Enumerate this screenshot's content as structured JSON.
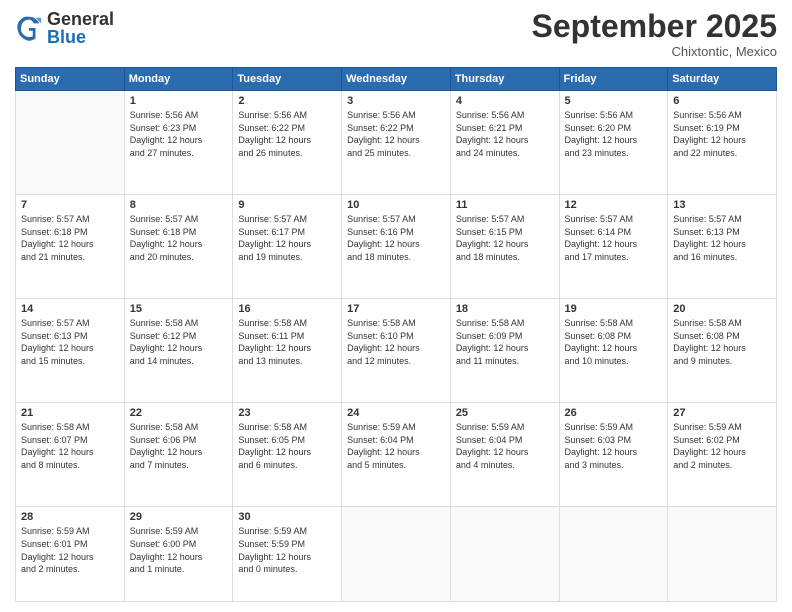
{
  "header": {
    "logo": {
      "general": "General",
      "blue": "Blue"
    },
    "month": "September 2025",
    "location": "Chixtontic, Mexico"
  },
  "weekdays": [
    "Sunday",
    "Monday",
    "Tuesday",
    "Wednesday",
    "Thursday",
    "Friday",
    "Saturday"
  ],
  "weeks": [
    [
      {
        "day": "",
        "info": ""
      },
      {
        "day": "1",
        "info": "Sunrise: 5:56 AM\nSunset: 6:23 PM\nDaylight: 12 hours\nand 27 minutes."
      },
      {
        "day": "2",
        "info": "Sunrise: 5:56 AM\nSunset: 6:22 PM\nDaylight: 12 hours\nand 26 minutes."
      },
      {
        "day": "3",
        "info": "Sunrise: 5:56 AM\nSunset: 6:22 PM\nDaylight: 12 hours\nand 25 minutes."
      },
      {
        "day": "4",
        "info": "Sunrise: 5:56 AM\nSunset: 6:21 PM\nDaylight: 12 hours\nand 24 minutes."
      },
      {
        "day": "5",
        "info": "Sunrise: 5:56 AM\nSunset: 6:20 PM\nDaylight: 12 hours\nand 23 minutes."
      },
      {
        "day": "6",
        "info": "Sunrise: 5:56 AM\nSunset: 6:19 PM\nDaylight: 12 hours\nand 22 minutes."
      }
    ],
    [
      {
        "day": "7",
        "info": "Sunrise: 5:57 AM\nSunset: 6:18 PM\nDaylight: 12 hours\nand 21 minutes."
      },
      {
        "day": "8",
        "info": "Sunrise: 5:57 AM\nSunset: 6:18 PM\nDaylight: 12 hours\nand 20 minutes."
      },
      {
        "day": "9",
        "info": "Sunrise: 5:57 AM\nSunset: 6:17 PM\nDaylight: 12 hours\nand 19 minutes."
      },
      {
        "day": "10",
        "info": "Sunrise: 5:57 AM\nSunset: 6:16 PM\nDaylight: 12 hours\nand 18 minutes."
      },
      {
        "day": "11",
        "info": "Sunrise: 5:57 AM\nSunset: 6:15 PM\nDaylight: 12 hours\nand 18 minutes."
      },
      {
        "day": "12",
        "info": "Sunrise: 5:57 AM\nSunset: 6:14 PM\nDaylight: 12 hours\nand 17 minutes."
      },
      {
        "day": "13",
        "info": "Sunrise: 5:57 AM\nSunset: 6:13 PM\nDaylight: 12 hours\nand 16 minutes."
      }
    ],
    [
      {
        "day": "14",
        "info": "Sunrise: 5:57 AM\nSunset: 6:13 PM\nDaylight: 12 hours\nand 15 minutes."
      },
      {
        "day": "15",
        "info": "Sunrise: 5:58 AM\nSunset: 6:12 PM\nDaylight: 12 hours\nand 14 minutes."
      },
      {
        "day": "16",
        "info": "Sunrise: 5:58 AM\nSunset: 6:11 PM\nDaylight: 12 hours\nand 13 minutes."
      },
      {
        "day": "17",
        "info": "Sunrise: 5:58 AM\nSunset: 6:10 PM\nDaylight: 12 hours\nand 12 minutes."
      },
      {
        "day": "18",
        "info": "Sunrise: 5:58 AM\nSunset: 6:09 PM\nDaylight: 12 hours\nand 11 minutes."
      },
      {
        "day": "19",
        "info": "Sunrise: 5:58 AM\nSunset: 6:08 PM\nDaylight: 12 hours\nand 10 minutes."
      },
      {
        "day": "20",
        "info": "Sunrise: 5:58 AM\nSunset: 6:08 PM\nDaylight: 12 hours\nand 9 minutes."
      }
    ],
    [
      {
        "day": "21",
        "info": "Sunrise: 5:58 AM\nSunset: 6:07 PM\nDaylight: 12 hours\nand 8 minutes."
      },
      {
        "day": "22",
        "info": "Sunrise: 5:58 AM\nSunset: 6:06 PM\nDaylight: 12 hours\nand 7 minutes."
      },
      {
        "day": "23",
        "info": "Sunrise: 5:58 AM\nSunset: 6:05 PM\nDaylight: 12 hours\nand 6 minutes."
      },
      {
        "day": "24",
        "info": "Sunrise: 5:59 AM\nSunset: 6:04 PM\nDaylight: 12 hours\nand 5 minutes."
      },
      {
        "day": "25",
        "info": "Sunrise: 5:59 AM\nSunset: 6:04 PM\nDaylight: 12 hours\nand 4 minutes."
      },
      {
        "day": "26",
        "info": "Sunrise: 5:59 AM\nSunset: 6:03 PM\nDaylight: 12 hours\nand 3 minutes."
      },
      {
        "day": "27",
        "info": "Sunrise: 5:59 AM\nSunset: 6:02 PM\nDaylight: 12 hours\nand 2 minutes."
      }
    ],
    [
      {
        "day": "28",
        "info": "Sunrise: 5:59 AM\nSunset: 6:01 PM\nDaylight: 12 hours\nand 2 minutes."
      },
      {
        "day": "29",
        "info": "Sunrise: 5:59 AM\nSunset: 6:00 PM\nDaylight: 12 hours\nand 1 minute."
      },
      {
        "day": "30",
        "info": "Sunrise: 5:59 AM\nSunset: 5:59 PM\nDaylight: 12 hours\nand 0 minutes."
      },
      {
        "day": "",
        "info": ""
      },
      {
        "day": "",
        "info": ""
      },
      {
        "day": "",
        "info": ""
      },
      {
        "day": "",
        "info": ""
      }
    ]
  ]
}
